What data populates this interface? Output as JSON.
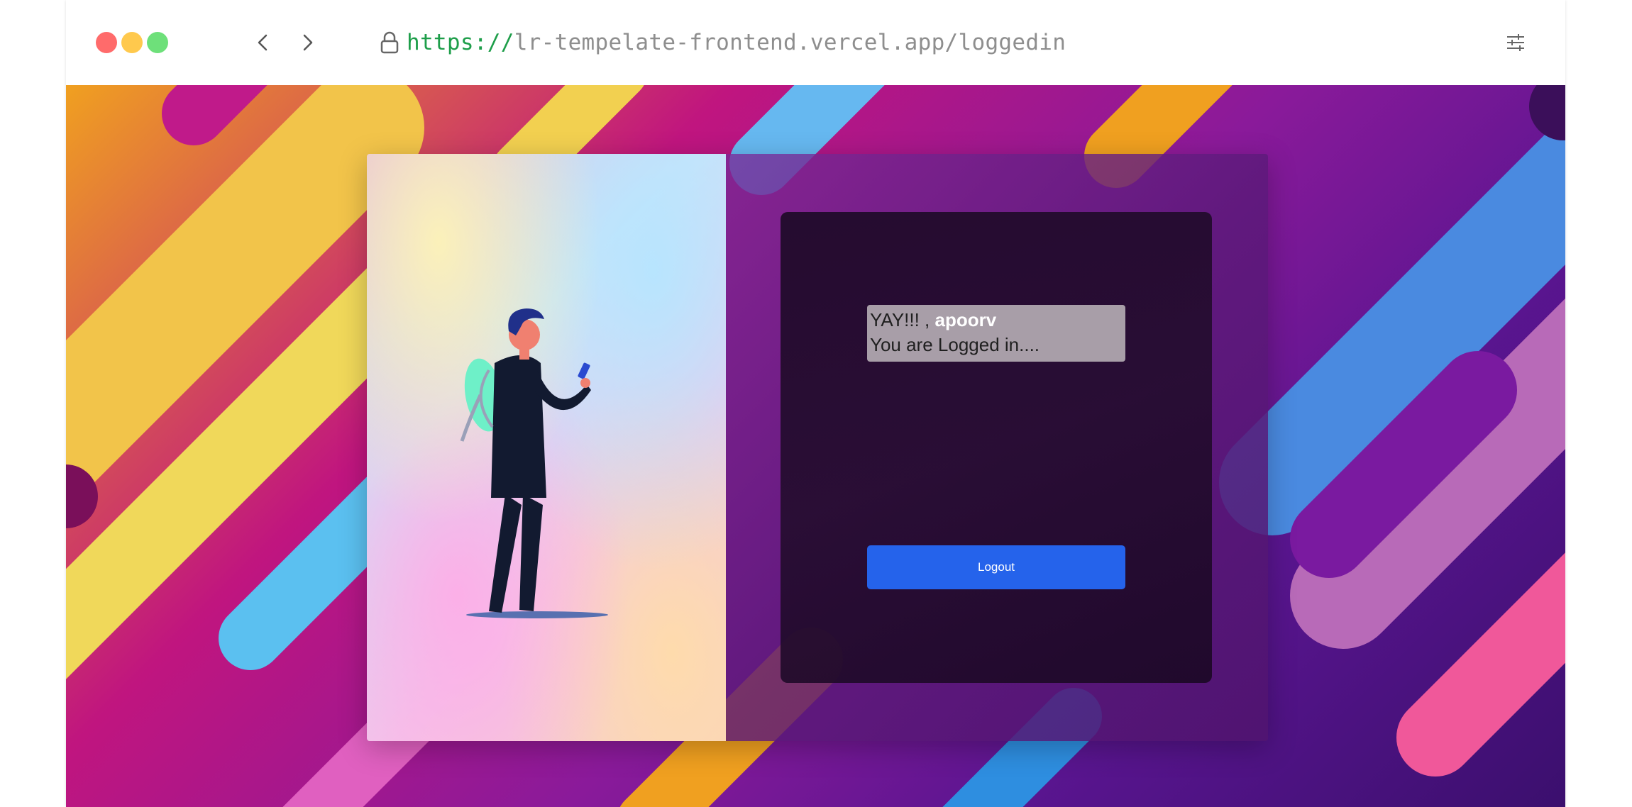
{
  "browser": {
    "url_scheme": "https://",
    "url_rest": "lr-tempelate-frontend.vercel.app/loggedin",
    "icons": [
      "chevron-left-icon",
      "chevron-right-icon",
      "lock-icon",
      "settings-sliders-icon"
    ]
  },
  "page": {
    "greeting_prefix": "YAY!!! , ",
    "username": "apoorv",
    "status_message": "You are Logged in....",
    "logout_label": "Logout"
  },
  "colors": {
    "accent": "#2563eb",
    "url_scheme": "#1e9e4a"
  }
}
